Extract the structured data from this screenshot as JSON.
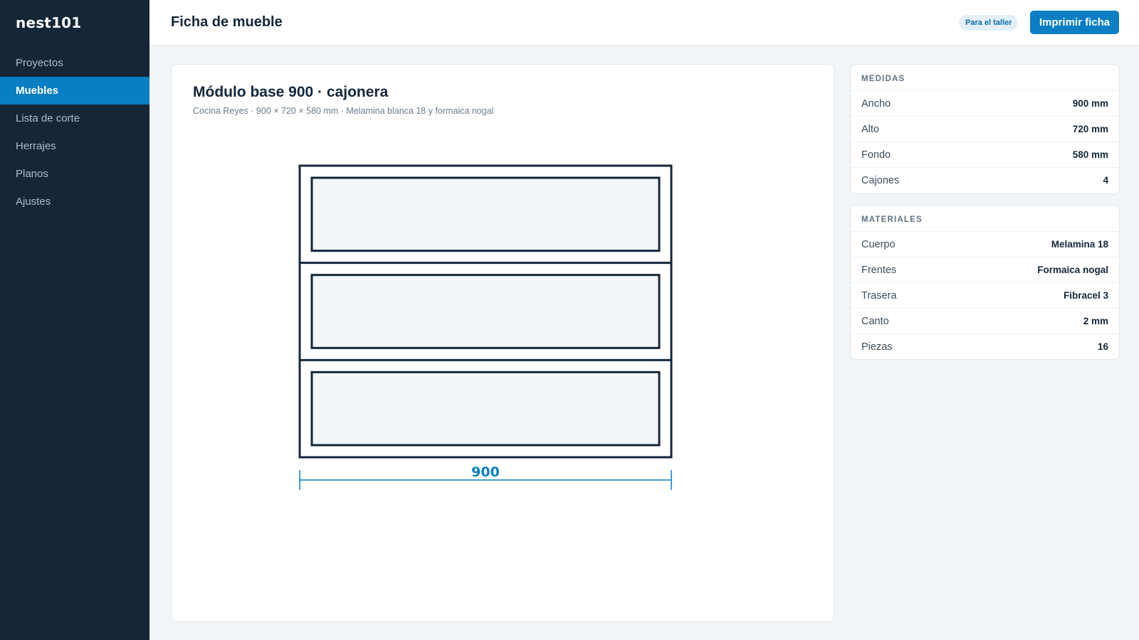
{
  "app": {
    "brand": "nest101"
  },
  "sidebar": {
    "items": [
      {
        "label": "Proyectos",
        "active": false
      },
      {
        "label": "Muebles",
        "active": true
      },
      {
        "label": "Lista de corte",
        "active": false
      },
      {
        "label": "Herrajes",
        "active": false
      },
      {
        "label": "Planos",
        "active": false
      },
      {
        "label": "Ajustes",
        "active": false
      }
    ]
  },
  "header": {
    "title": "Ficha de mueble",
    "badge": "Para el taller",
    "print_label": "Imprimir ficha"
  },
  "module": {
    "title": "Módulo base 900 · cajonera",
    "subtitle": "Cocina Reyes · 900 × 720 × 580 mm · Melamina blanca 18 y formaica nogal",
    "drawing": {
      "drawer_count": 3,
      "width_label": "900"
    }
  },
  "medidas": {
    "heading": "MEDIDAS",
    "rows": [
      {
        "label": "Ancho",
        "value": "900 mm"
      },
      {
        "label": "Alto",
        "value": "720 mm"
      },
      {
        "label": "Fondo",
        "value": "580 mm"
      },
      {
        "label": "Cajones",
        "value": "4"
      }
    ]
  },
  "materiales": {
    "heading": "MATERIALES",
    "rows": [
      {
        "label": "Cuerpo",
        "value": "Melamina 18"
      },
      {
        "label": "Frentes",
        "value": "Formaica nogal"
      },
      {
        "label": "Trasera",
        "value": "Fibracel 3"
      },
      {
        "label": "Canto",
        "value": "2 mm"
      },
      {
        "label": "Piezas",
        "value": "16"
      }
    ]
  },
  "colors": {
    "sidebar_bg": "#152636",
    "accent": "#0a7ec2",
    "drawing_stroke": "#15273a",
    "drawer_fill": "#f3f6f9"
  }
}
